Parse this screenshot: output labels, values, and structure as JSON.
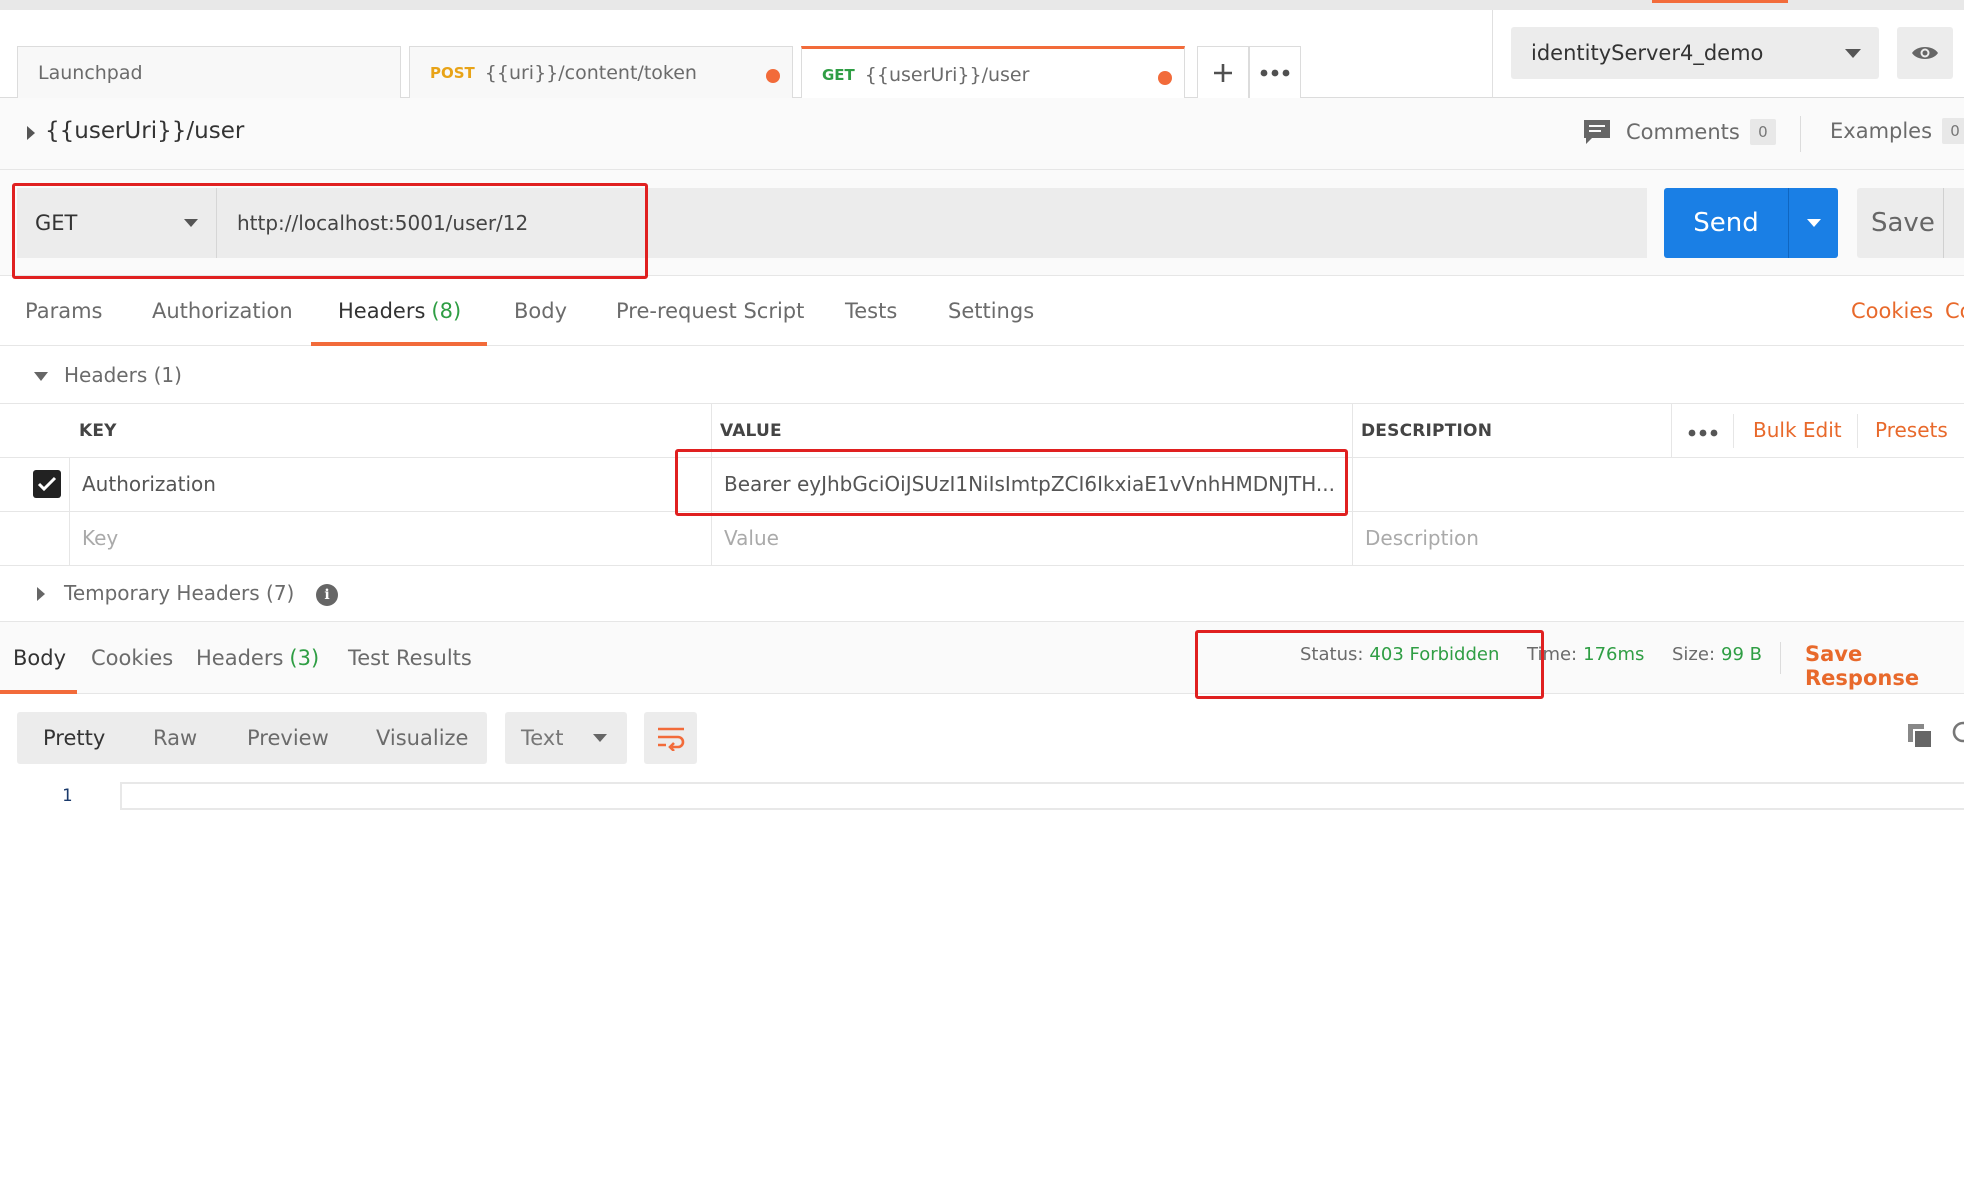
{
  "tabs": [
    {
      "label": "Launchpad",
      "method": ""
    },
    {
      "label": "{{uri}}/content/token",
      "method": "POST"
    },
    {
      "label": "{{userUri}}/user",
      "method": "GET"
    }
  ],
  "tab_actions": {
    "add_icon": "plus-icon",
    "more_icon": "more-dots-icon"
  },
  "environment": {
    "selected": "identityServer4_demo"
  },
  "request": {
    "title": "{{userUri}}/user",
    "method": "GET",
    "url": "http://localhost:5001/user/12",
    "send_label": "Send",
    "save_label": "Save"
  },
  "meta": {
    "comments_label": "Comments",
    "comments_count": "0",
    "examples_label": "Examples",
    "examples_count": "0"
  },
  "request_tabs": {
    "params": "Params",
    "authorization": "Authorization",
    "headers": "Headers",
    "headers_count": "(8)",
    "body": "Body",
    "prerequest": "Pre-request Script",
    "tests": "Tests",
    "settings": "Settings",
    "cookies": "Cookies",
    "code_partial": "Co"
  },
  "headers_section": {
    "label": "Headers (1)"
  },
  "headers_table": {
    "columns": {
      "key": "KEY",
      "value": "VALUE",
      "description": "DESCRIPTION"
    },
    "bulk_edit": "Bulk Edit",
    "presets": "Presets",
    "rows": [
      {
        "key": "Authorization",
        "value": "Bearer  eyJhbGciOiJSUzI1NiIsImtpZCI6IkxiaE1vVnhHMDNJTH...",
        "description": "",
        "checked": true
      }
    ],
    "placeholders": {
      "key": "Key",
      "value": "Value",
      "description": "Description"
    }
  },
  "temporary_headers": {
    "label": "Temporary Headers (7)"
  },
  "response_tabs": {
    "body": "Body",
    "cookies": "Cookies",
    "headers": "Headers",
    "headers_count": "(3)",
    "test_results": "Test Results"
  },
  "response_status": {
    "status_label": "Status:",
    "status_value": "403 Forbidden",
    "time_label": "Time:",
    "time_value": "176ms",
    "size_label": "Size:",
    "size_value": "99 B",
    "save_response": "Save Response"
  },
  "view_modes": {
    "pretty": "Pretty",
    "raw": "Raw",
    "preview": "Preview",
    "visualize": "Visualize",
    "format": "Text"
  },
  "editor": {
    "line_number": "1"
  },
  "colors": {
    "accent": "#f26b3a",
    "send": "#1a7fe5",
    "ok": "#2f9e44",
    "highlight": "#e02020"
  }
}
